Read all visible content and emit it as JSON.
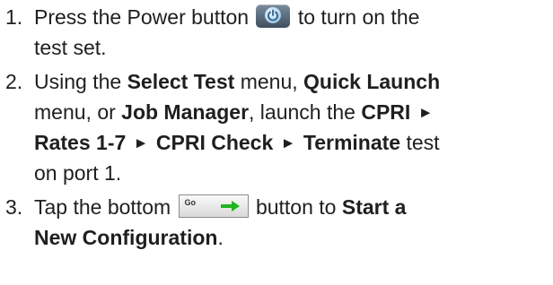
{
  "steps": [
    {
      "number": "1.",
      "line1": {
        "before_icon": "Press the Power button",
        "after_icon": "to turn on the"
      },
      "line2": "test set.",
      "icon": "power-icon"
    },
    {
      "number": "2.",
      "line1": {
        "t1": "Using the ",
        "b1": "Select Test",
        "t2": " menu, ",
        "b2": "Quick Launch"
      },
      "line2": {
        "t1": "menu, or ",
        "b1": "Job Manager",
        "t2": ", launch the ",
        "b2": "CPRI"
      },
      "line3": {
        "b1": "Rates 1-7",
        "b2": "CPRI Check",
        "b3": "Terminate",
        "t1": " test"
      },
      "line4": "on port 1.",
      "arrow_glyph": "►"
    },
    {
      "number": "3.",
      "line1": {
        "before_icon": "Tap the bottom",
        "after_icon": "button to ",
        "b1": "Start a"
      },
      "line2": {
        "b1": "New Configuration",
        "t1": "."
      },
      "button_label": "Go",
      "icon": "right-arrow-icon",
      "arrow_color": "#1fb51f"
    }
  ]
}
